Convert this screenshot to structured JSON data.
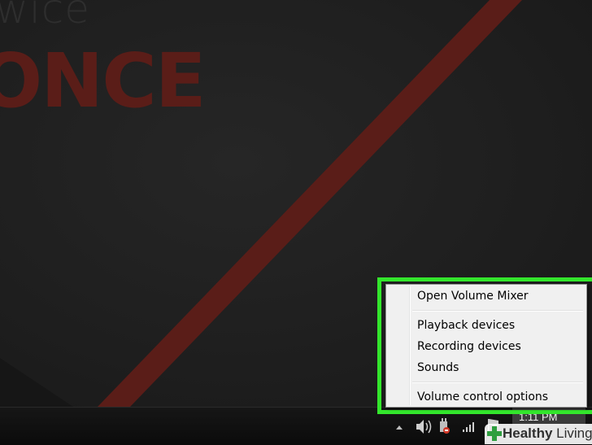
{
  "wallpaper": {
    "word_small": "wice",
    "word_big": "ONCE",
    "stripe_color": "#5a1d18"
  },
  "context_menu": {
    "items": [
      {
        "label": "Open Volume Mixer",
        "bold": true
      },
      {
        "label": "Playback devices"
      },
      {
        "label": "Recording devices"
      },
      {
        "label": "Sounds"
      },
      {
        "label": "Volume control options"
      }
    ]
  },
  "highlight_color": "#33e62c",
  "taskbar": {
    "clock": "1:11 PM",
    "tray_icons": [
      "show-hidden-icons-arrow",
      "speaker-volume-icon",
      "power-plug-icon",
      "signal-bars-icon",
      "action-center-flag-icon"
    ]
  },
  "watermark": {
    "brand_bold": "Healthy",
    "brand_regular": "Living",
    "cross_color": "#2e9e3f"
  }
}
